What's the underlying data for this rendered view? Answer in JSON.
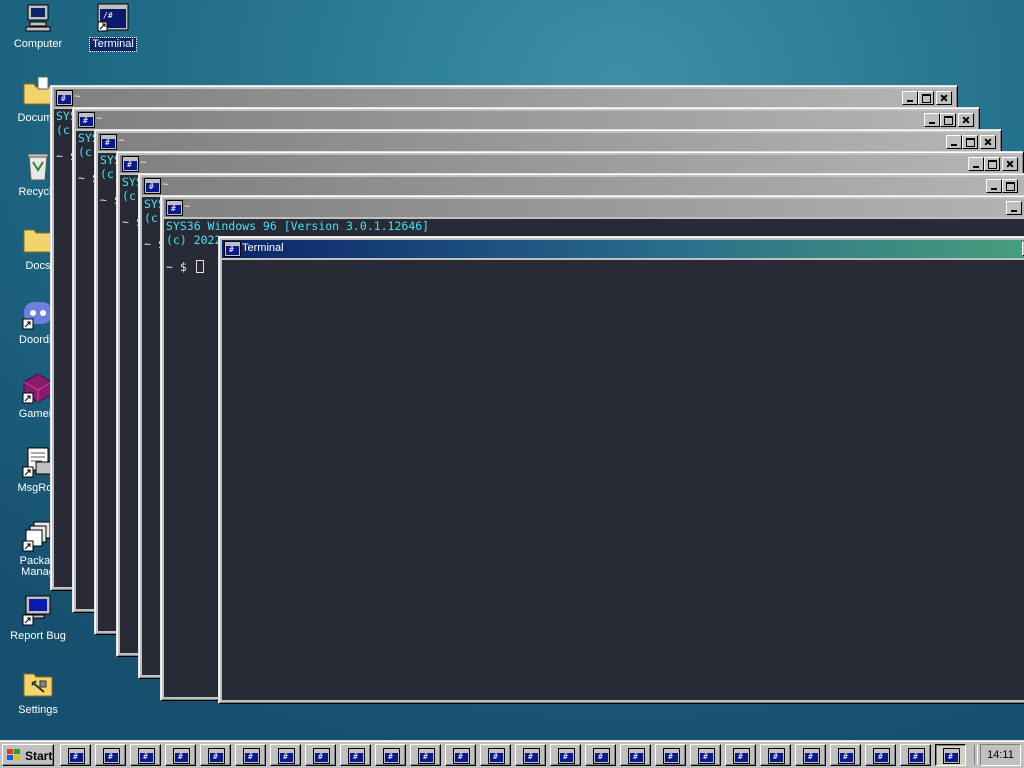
{
  "desktop": {
    "icons": [
      {
        "label": "Computer",
        "icon": "computer-icon"
      },
      {
        "label": "Terminal",
        "icon": "terminal-icon",
        "selected": true
      },
      {
        "label": "Docume",
        "icon": "documents-folder-icon"
      },
      {
        "label": "Recycle",
        "icon": "recycle-bin-icon"
      },
      {
        "label": "Docs",
        "icon": "folder-icon"
      },
      {
        "label": "Doordis",
        "icon": "doordis-icon"
      },
      {
        "label": "Gamein",
        "icon": "gamein-icon"
      },
      {
        "label": "MsgRoo",
        "icon": "msgroom-icon"
      },
      {
        "label": "Packag\nManag",
        "icon": "package-manager-icon"
      },
      {
        "label": "Report Bug",
        "icon": "report-bug-icon"
      },
      {
        "label": "Settings",
        "icon": "settings-icon"
      }
    ]
  },
  "windows": {
    "back_title": "~",
    "front_title": "Terminal",
    "banner_line1": "SYS36 Windows 96 [Version 3.0.1.12646]",
    "banner_line2": "(c) 2022 ",
    "clipped_line1": "SYS",
    "clipped_line2": "(c)",
    "prompt": "~ $",
    "clipped_prompt": "~ $"
  },
  "taskbar": {
    "start_label": "Start",
    "task_count": 26,
    "active_task_index": 25,
    "clock": "14:11"
  },
  "colors": {
    "terminal_bg": "#282a36",
    "terminal_text": "#44e2f0",
    "active_title_start": "#0a246a",
    "active_title_end": "#49a07a",
    "chrome": "#c0c0c0"
  }
}
